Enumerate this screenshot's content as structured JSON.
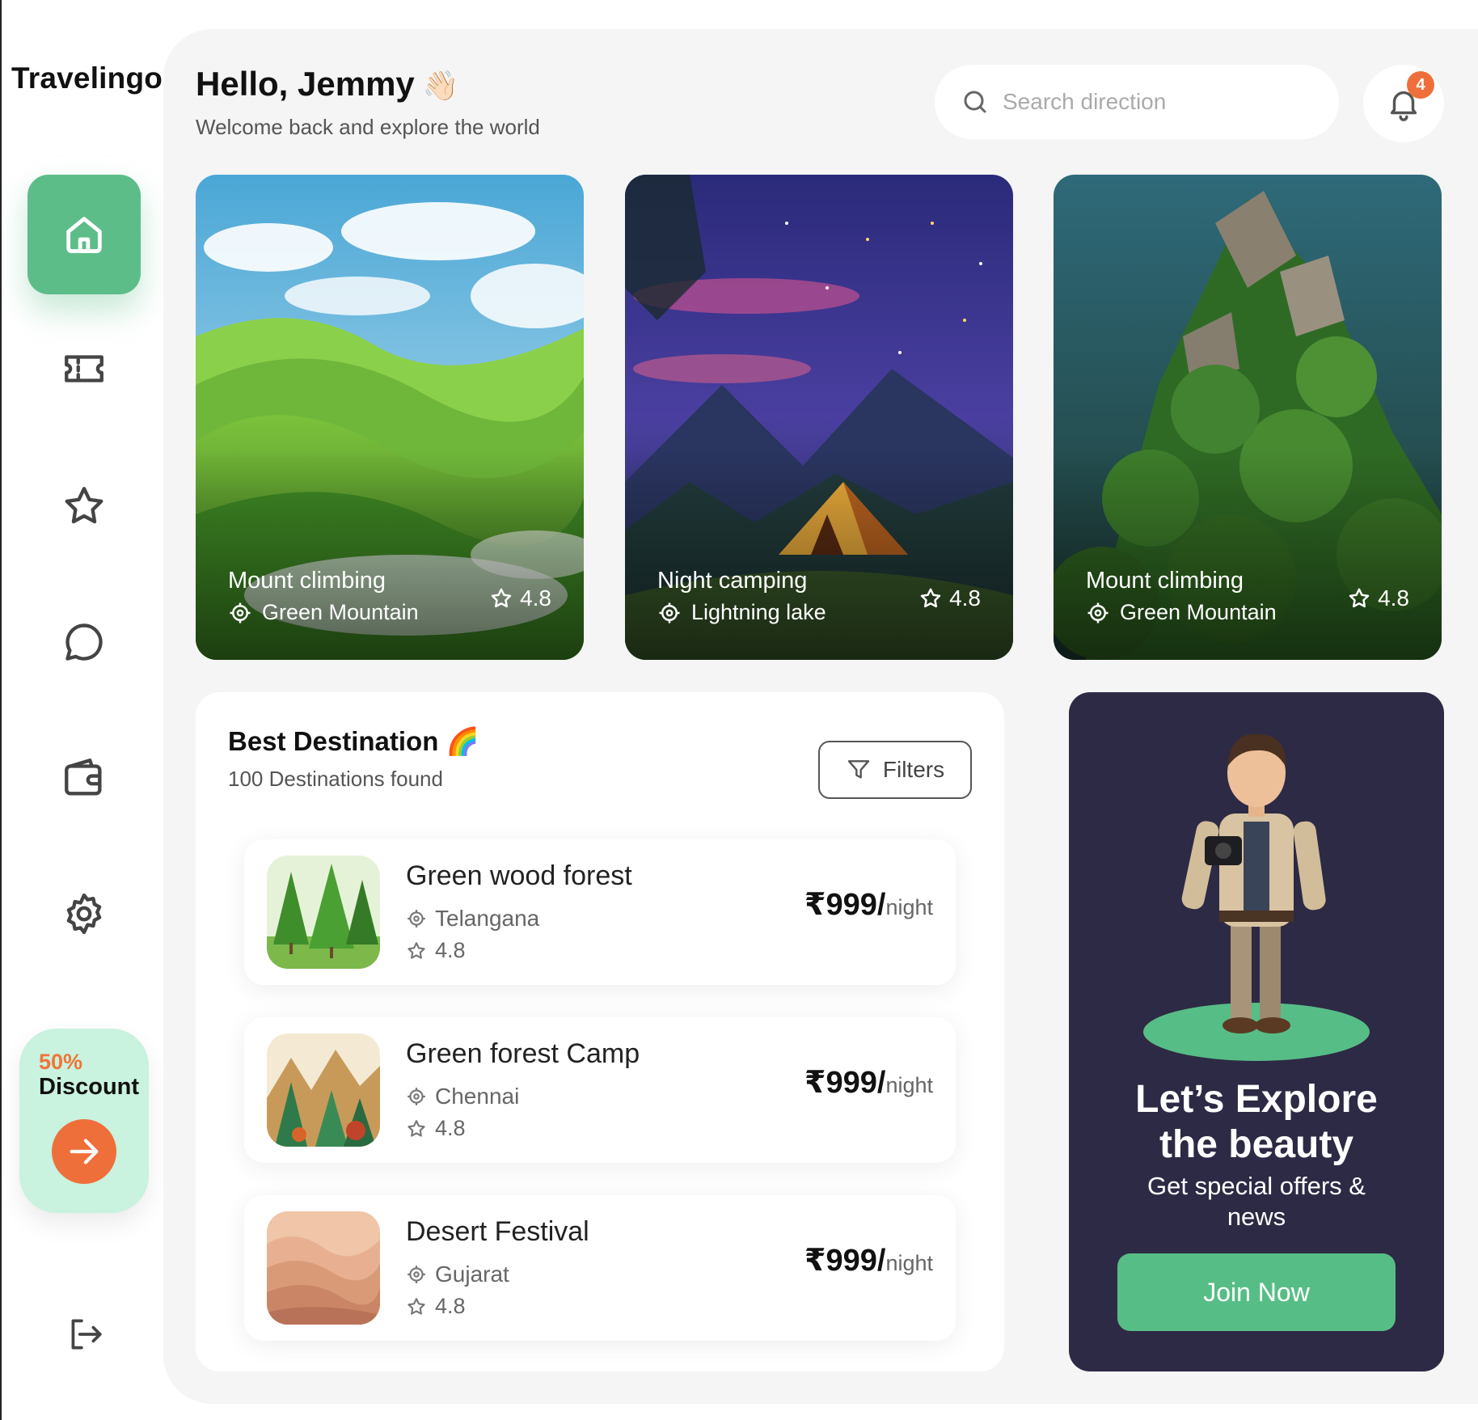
{
  "sidebar": {
    "logo": "Travelingo",
    "nav": [
      {
        "name": "home",
        "icon": "home-icon",
        "active": true
      },
      {
        "name": "tickets",
        "icon": "ticket-icon"
      },
      {
        "name": "favorites",
        "icon": "star-icon"
      },
      {
        "name": "messages",
        "icon": "chat-icon"
      },
      {
        "name": "wallet",
        "icon": "wallet-icon"
      },
      {
        "name": "settings",
        "icon": "gear-icon"
      }
    ],
    "promo": {
      "percent": "50%",
      "label": "Discount",
      "icon": "arrow-right-icon"
    },
    "logout_icon": "logout-icon"
  },
  "header": {
    "greeting": "Hello, Jemmy",
    "wave_emoji": "👋🏻",
    "subtitle": "Welcome back and explore the world",
    "search_placeholder": "Search direction",
    "notification_count": "4"
  },
  "featured": [
    {
      "title": "Mount climbing",
      "location": "Green Mountain",
      "rating": "4.8"
    },
    {
      "title": "Night camping",
      "location": "Lightning lake",
      "rating": "4.8"
    },
    {
      "title": "Mount climbing",
      "location": "Green Mountain",
      "rating": "4.8"
    }
  ],
  "destinations": {
    "title": "Best Destination",
    "title_emoji": "🌈",
    "count": "100 Destinations found",
    "filters_label": "Filters",
    "items": [
      {
        "name": "Green wood forest",
        "location": "Telangana",
        "rating": "4.8",
        "price": "₹999/",
        "unit": "night"
      },
      {
        "name": "Green forest Camp",
        "location": "Chennai",
        "rating": "4.8",
        "price": "₹999/",
        "unit": "night"
      },
      {
        "name": "Desert Festival",
        "location": "Gujarat",
        "rating": "4.8",
        "price": "₹999/",
        "unit": "night"
      }
    ]
  },
  "explore": {
    "title_line1": "Let’s Explore",
    "title_line2": "the beauty",
    "subtitle_line1": "Get special offers &",
    "subtitle_line2": "news",
    "cta": "Join Now"
  },
  "colors": {
    "accent": "#5cbd88",
    "orange": "#ef6f3a",
    "dark_panel": "#2d2a45",
    "promo_bg": "#c9f2df"
  }
}
